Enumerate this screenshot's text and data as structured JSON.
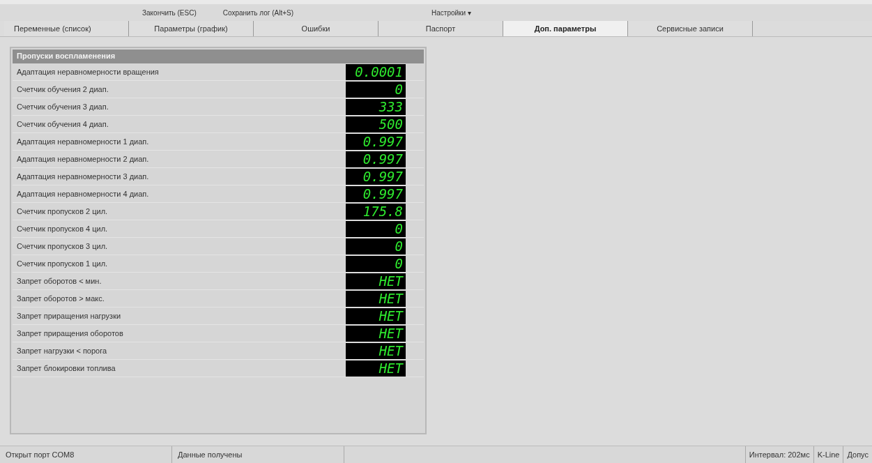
{
  "toolbar": [
    "Закончить (ESC)",
    "Сохранить лог (Alt+S)",
    "Настройки ▾"
  ],
  "tabs": [
    {
      "label": "Переменные (список)",
      "selected": false
    },
    {
      "label": "Параметры (график)",
      "selected": false
    },
    {
      "label": "Ошибки",
      "selected": false
    },
    {
      "label": "Паспорт",
      "selected": false
    },
    {
      "label": "Доп. параметры",
      "selected": true
    },
    {
      "label": "Сервисные записи",
      "selected": false
    }
  ],
  "panel": {
    "title": "Пропуски воспламенения",
    "rows": [
      {
        "name": "Адаптация неравномерности вращения",
        "value": "0.0001"
      },
      {
        "name": "Счетчик обучения 2 диап.",
        "value": "0"
      },
      {
        "name": "Счетчик обучения 3 диап.",
        "value": "333"
      },
      {
        "name": "Счетчик обучения 4 диап.",
        "value": "500"
      },
      {
        "name": "Адаптация неравномерности 1 диап.",
        "value": "0.997"
      },
      {
        "name": "Адаптация неравномерности 2 диап.",
        "value": "0.997"
      },
      {
        "name": "Адаптация неравномерности 3 диап.",
        "value": "0.997"
      },
      {
        "name": "Адаптация неравномерности 4 диап.",
        "value": "0.997"
      },
      {
        "name": "Счетчик пропусков 2 цил.",
        "value": "175.8"
      },
      {
        "name": "Счетчик пропусков 4 цил.",
        "value": "0"
      },
      {
        "name": "Счетчик пропусков 3 цил.",
        "value": "0"
      },
      {
        "name": "Счетчик пропусков 1 цил.",
        "value": "0"
      },
      {
        "name": "Запрет оборотов < мин.",
        "value": "НЕТ"
      },
      {
        "name": "Запрет оборотов > макс.",
        "value": "НЕТ"
      },
      {
        "name": "Запрет приращения нагрузки",
        "value": "НЕТ"
      },
      {
        "name": "Запрет приращения оборотов",
        "value": "НЕТ"
      },
      {
        "name": "Запрет нагрузки < порога",
        "value": "НЕТ"
      },
      {
        "name": "Запрет блокировки топлива",
        "value": "НЕТ"
      }
    ]
  },
  "status_bar": {
    "left": [
      "Открыт порт COM8",
      "Данные получены"
    ],
    "right": [
      "Интервал: 202мс",
      "K-Line",
      "Допус"
    ]
  }
}
